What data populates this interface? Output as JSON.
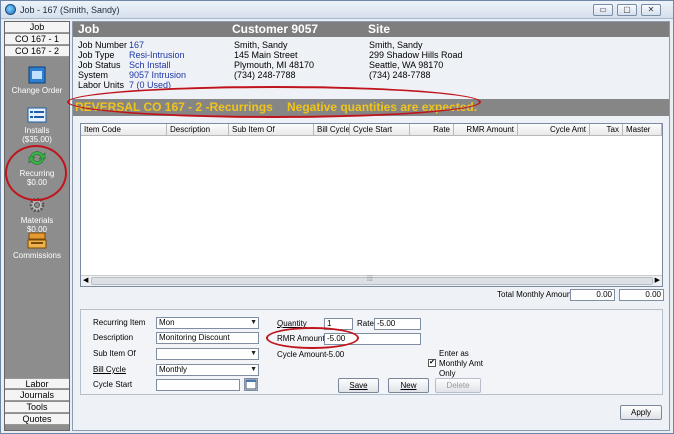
{
  "window": {
    "title": "Job - 167 (Smith, Sandy)",
    "btn_min": "▭",
    "btn_max": "▢",
    "btn_close": "✕"
  },
  "nav": {
    "tabs": [
      "Job",
      "CO 167 - 1",
      "CO 167 - 2"
    ],
    "items": [
      {
        "label": "Change Order",
        "sub": ""
      },
      {
        "label": "Installs",
        "sub": "($35.00)"
      },
      {
        "label": "Recurring",
        "sub": "$0.00"
      },
      {
        "label": "Materials",
        "sub": "$0.00"
      },
      {
        "label": "Commissions",
        "sub": ""
      }
    ],
    "bottom_tabs": [
      "Labor",
      "Journals",
      "Tools",
      "Quotes"
    ]
  },
  "header": {
    "job": "Job",
    "customer": "Customer 9057",
    "site": "Site"
  },
  "job_info": {
    "labels": [
      "Job Number",
      "Job Type",
      "Job Status",
      "System",
      "Labor Units"
    ],
    "values": [
      "167",
      "Resi-Intrusion",
      "Sch Install",
      "9057 Intrusion",
      "7 (0 Used)"
    ]
  },
  "customer_info": [
    "Smith, Sandy",
    "145 Main Street",
    "Plymouth, MI  48170",
    "(734) 248-7788"
  ],
  "site_info": [
    "Smith, Sandy",
    "299 Shadow Hills Road",
    "Seattle, WA  98170",
    "(734) 248-7788"
  ],
  "reversal": {
    "title": "REVERSAL  CO 167 - 2 -Recurrings",
    "message": "Negative quantities are expected."
  },
  "grid": {
    "columns": [
      "Item Code",
      "Description",
      "Sub Item Of",
      "Bill Cycle",
      "Cycle Start",
      "Rate",
      "RMR Amount",
      "Cycle Amt",
      "Tax",
      "Master"
    ]
  },
  "totals": {
    "label": "Total Monthly Amount",
    "value1": "0.00",
    "value2": "0.00"
  },
  "form": {
    "recurring_item_label": "Recurring Item",
    "recurring_item_value": "Mon",
    "description_label": "Description",
    "description_value": "Monitoring Discount",
    "sub_item_label": "Sub Item Of",
    "sub_item_value": "",
    "bill_cycle_label": "Bill Cycle",
    "bill_cycle_value": "Monthly",
    "cycle_start_label": "Cycle Start",
    "cycle_start_value": "",
    "quantity_label": "Quantity",
    "quantity_value": "1",
    "rate_label": "Rate",
    "rate_value": "-5.00",
    "rmr_label": "RMR Amount",
    "rmr_value": "-5.00",
    "cycle_amount_label": "Cycle Amount",
    "cycle_amount_value": "-5.00",
    "enter_as_label": "Enter as Monthly Amt Only",
    "enter_as_checked": "✔",
    "save": "Save",
    "new": "New",
    "delete": "Delete"
  },
  "apply": "Apply"
}
